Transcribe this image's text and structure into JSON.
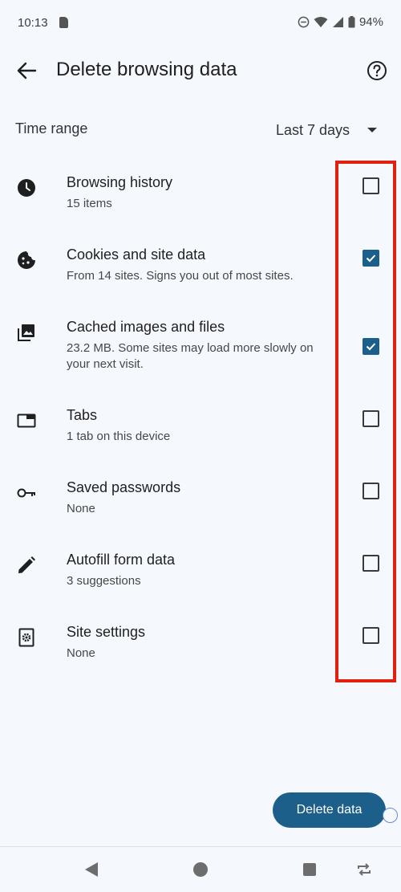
{
  "status_bar": {
    "time": "10:13",
    "battery": "94%"
  },
  "header": {
    "title": "Delete browsing data"
  },
  "time_range": {
    "label": "Time range",
    "value": "Last 7 days"
  },
  "items": [
    {
      "title": "Browsing history",
      "subtitle": "15 items",
      "checked": false,
      "icon": "clock-icon"
    },
    {
      "title": "Cookies and site data",
      "subtitle": "From 14 sites. Signs you out of most sites.",
      "checked": true,
      "icon": "cookie-icon"
    },
    {
      "title": "Cached images and files",
      "subtitle": "23.2 MB. Some sites may load more slowly on your next visit.",
      "checked": true,
      "icon": "images-icon"
    },
    {
      "title": "Tabs",
      "subtitle": "1 tab on this device",
      "checked": false,
      "icon": "tab-icon"
    },
    {
      "title": "Saved passwords",
      "subtitle": "None",
      "checked": false,
      "icon": "key-icon"
    },
    {
      "title": "Autofill form data",
      "subtitle": "3 suggestions",
      "checked": false,
      "icon": "pencil-icon"
    },
    {
      "title": "Site settings",
      "subtitle": "None",
      "checked": false,
      "icon": "site-settings-icon"
    }
  ],
  "actions": {
    "delete_label": "Delete data"
  },
  "colors": {
    "accent": "#1b5f8a",
    "highlight": "#e1200f",
    "background": "#f5f8fd"
  }
}
